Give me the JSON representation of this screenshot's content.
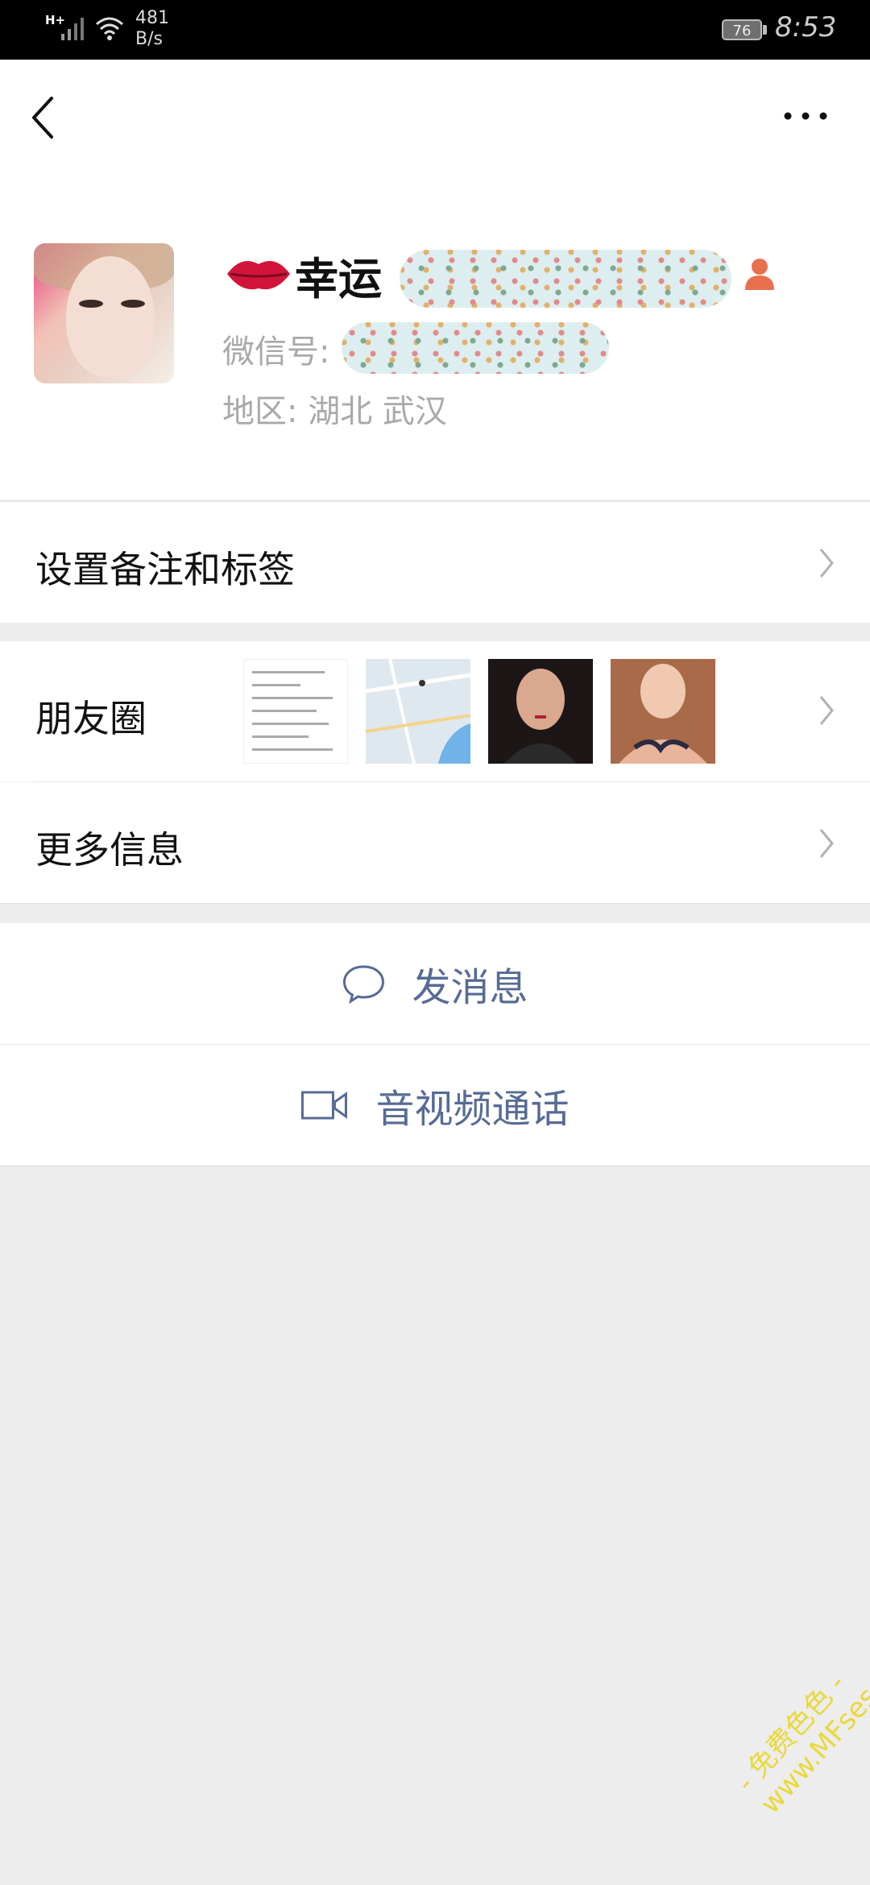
{
  "status_bar": {
    "network": "H+",
    "speed": "481",
    "speed_unit": "B/s",
    "battery": "76",
    "time": "8:53"
  },
  "profile": {
    "name": "幸运",
    "wechat_id_label": "微信号:",
    "region": "地区: 湖北  武汉"
  },
  "menu": {
    "remark_label": "设置备注和标签",
    "moments_label": "朋友圈",
    "more_info_label": "更多信息"
  },
  "actions": {
    "message_label": "发消息",
    "call_label": "音视频通话"
  },
  "watermark": {
    "line1": "- 免费色色 -",
    "line2": "www.MFsese.com"
  },
  "colors": {
    "link_blue": "#576b95",
    "background": "#ededed"
  },
  "icons": [
    "back-icon",
    "more-icon",
    "lips-icon",
    "person-icon",
    "chevron-right-icon",
    "chat-bubble-icon",
    "video-camera-icon"
  ]
}
